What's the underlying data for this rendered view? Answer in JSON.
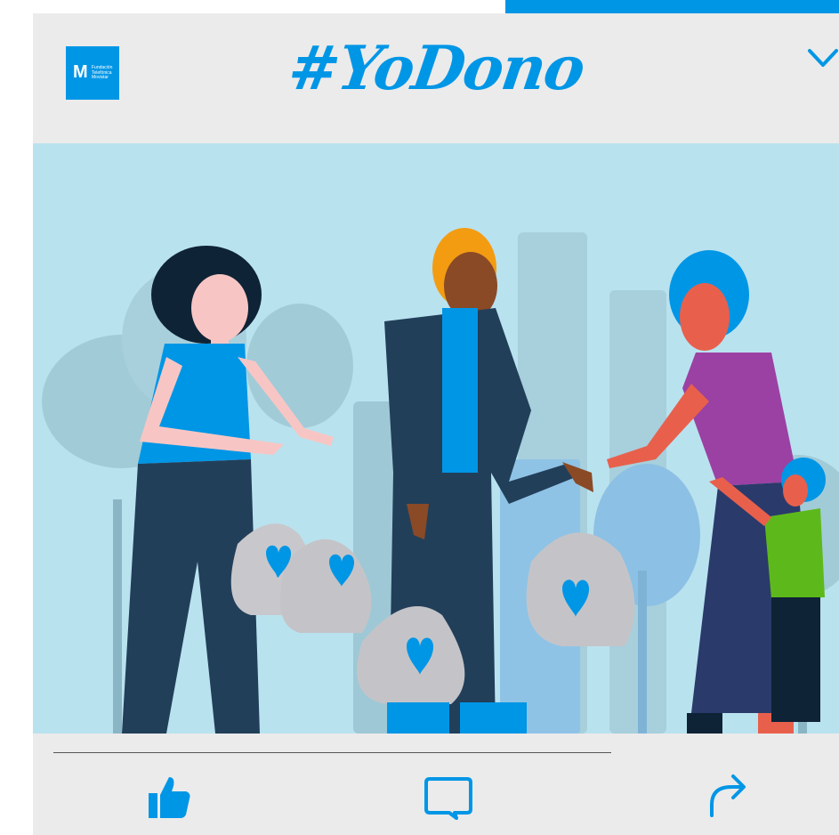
{
  "header": {
    "title": "#YoDono",
    "logo": {
      "mark": "M",
      "text": "Fundación Telefónica Movistar",
      "icon": "movistar-logo"
    },
    "menu_icon": "chevron-down-icon"
  },
  "actions": {
    "like_icon": "thumbs-up-icon",
    "comment_icon": "comment-icon",
    "share_icon": "share-icon"
  },
  "colors": {
    "brand": "#0096e6",
    "background": "#ebebeb",
    "scene_sky": "#b9e2ef"
  }
}
